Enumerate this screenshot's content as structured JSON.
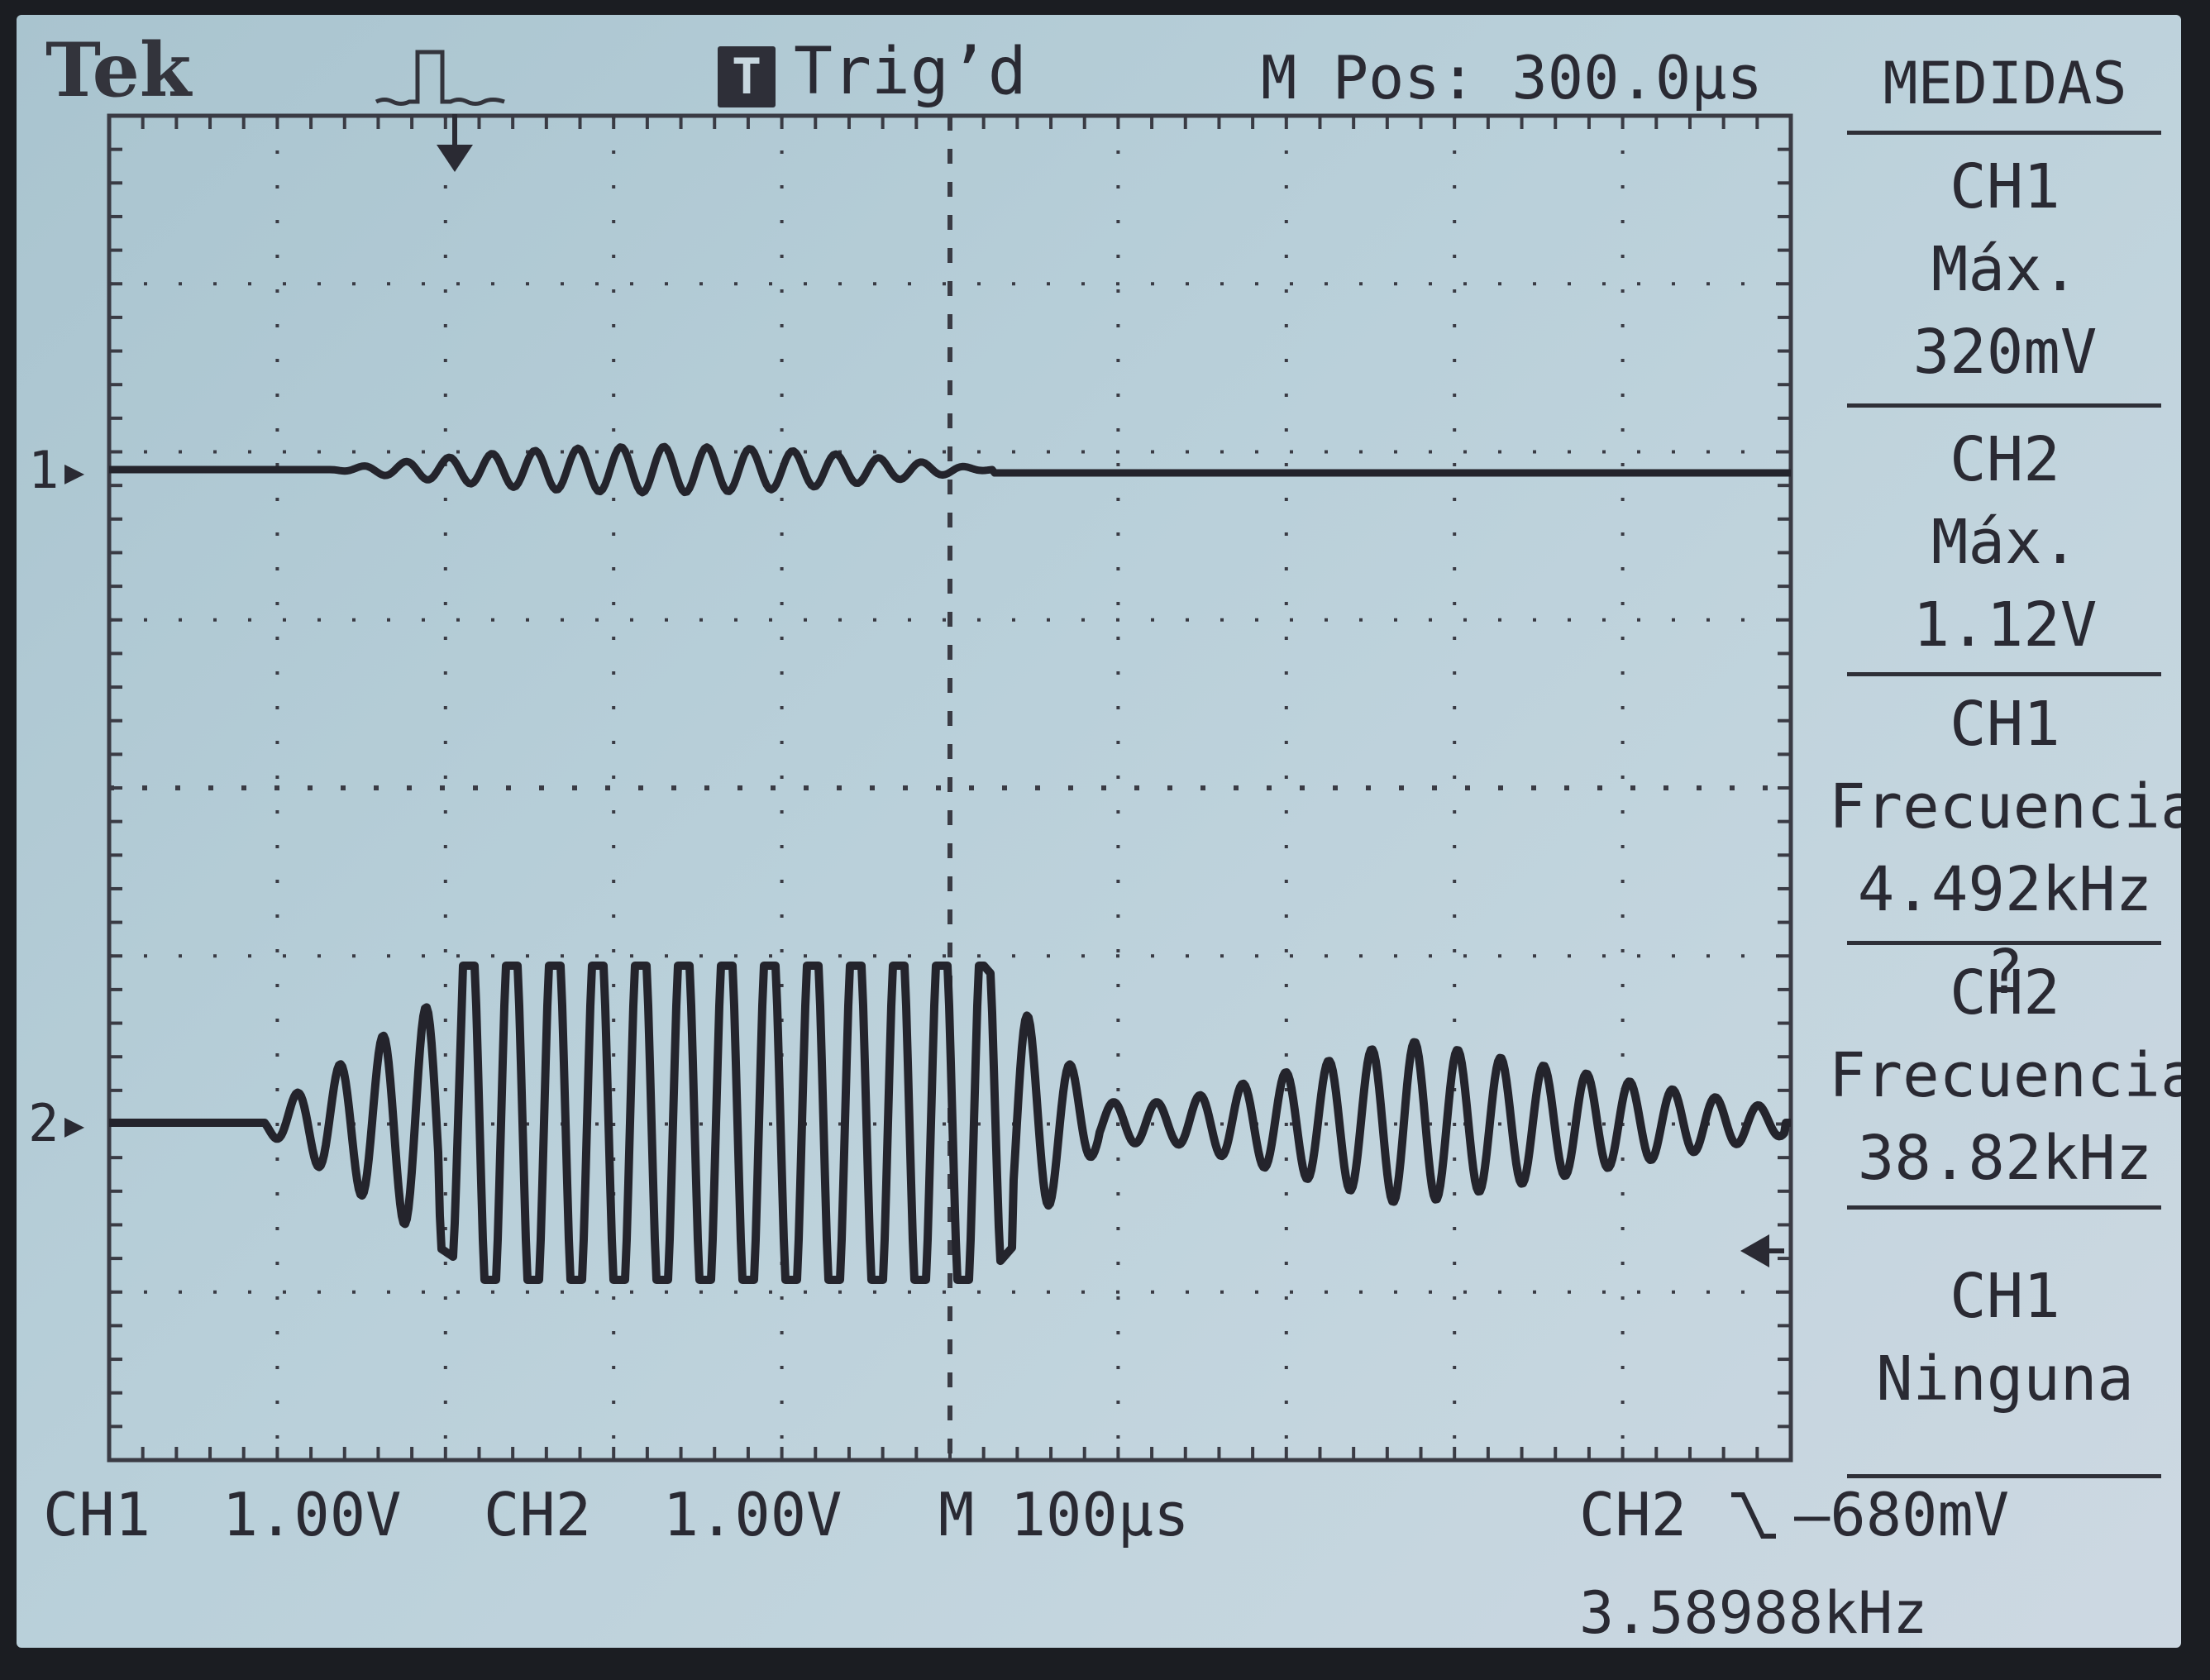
{
  "header": {
    "brand": "Tek",
    "trigger_badge": "T",
    "trigger_status": "Trig’d",
    "horizontal_position": "M Pos: 300.0µs"
  },
  "channel_markers": {
    "ch1": "1▸",
    "ch2": "2▸"
  },
  "measurements": {
    "title": "MEDIDAS",
    "items": [
      {
        "channel": "CH1",
        "type": "Máx.",
        "value": "320mV"
      },
      {
        "channel": "CH2",
        "type": "Máx.",
        "value": "1.12V"
      },
      {
        "channel": "CH1",
        "type": "Frecuencia",
        "value": "4.492kHz ?"
      },
      {
        "channel": "CH2",
        "type": "Frecuencia",
        "value": "38.82kHz"
      },
      {
        "channel": "CH1",
        "type": "Ninguna",
        "value": ""
      }
    ]
  },
  "status_bar": {
    "ch1_scale": "CH1  1.00V",
    "ch2_scale": "CH2  1.00V",
    "timebase": "M 100µs",
    "trigger_source": "CH2",
    "trigger_level": "–680mV",
    "trigger_frequency": "3.58988kHz"
  },
  "colors": {
    "trace": "#24242c",
    "screen": "#b8cfd9",
    "grid": "#3a3b44"
  },
  "icons": {
    "trigger_pulse": "pulse-waveform-icon",
    "trigger_position": "down-arrow-icon",
    "trigger_level": "left-arrow-icon",
    "slope": "falling-slope-icon"
  }
}
